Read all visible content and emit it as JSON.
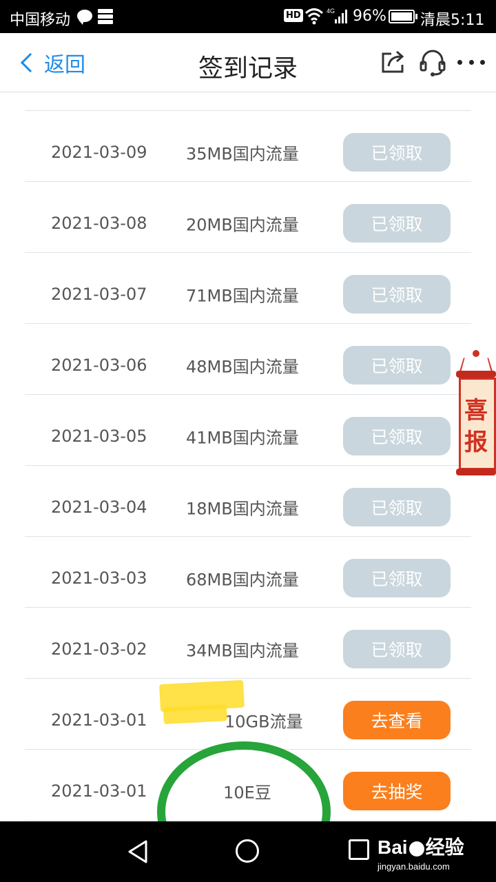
{
  "status_bar": {
    "carrier": "中国移动",
    "battery": "96%",
    "time": "清晨5:11",
    "hd": "HD",
    "network": "4G"
  },
  "nav": {
    "back_label": "返回",
    "title": "签到记录"
  },
  "records": [
    {
      "date": "2021-03-09",
      "reward": "35MB国内流量",
      "action": "已领取",
      "state": "claimed"
    },
    {
      "date": "2021-03-08",
      "reward": "20MB国内流量",
      "action": "已领取",
      "state": "claimed"
    },
    {
      "date": "2021-03-07",
      "reward": "71MB国内流量",
      "action": "已领取",
      "state": "claimed"
    },
    {
      "date": "2021-03-06",
      "reward": "48MB国内流量",
      "action": "已领取",
      "state": "claimed"
    },
    {
      "date": "2021-03-05",
      "reward": "41MB国内流量",
      "action": "已领取",
      "state": "claimed"
    },
    {
      "date": "2021-03-04",
      "reward": "18MB国内流量",
      "action": "已领取",
      "state": "claimed"
    },
    {
      "date": "2021-03-03",
      "reward": "68MB国内流量",
      "action": "已领取",
      "state": "claimed"
    },
    {
      "date": "2021-03-02",
      "reward": "34MB国内流量",
      "action": "已领取",
      "state": "claimed"
    },
    {
      "date": "2021-03-01",
      "reward": "10GB流量",
      "action": "去查看",
      "state": "active"
    },
    {
      "date": "2021-03-01",
      "reward": "10E豆",
      "action": "去抽奖",
      "state": "active"
    }
  ],
  "promo_badge": {
    "line1": "喜",
    "line2": "报"
  },
  "watermark": {
    "brand": "Bai",
    "brand2": "经验",
    "url": "jingyan.baidu.com"
  },
  "colors": {
    "accent": "#1f8ce8",
    "claimed_button": "#c9d6dd",
    "active_button": "#fb7f1d",
    "circle_annotation": "#27a43a",
    "highlighter": "#ffdc28"
  },
  "icons": {
    "back": "chevron-left-icon",
    "share": "share-icon",
    "support": "headset-icon",
    "more": "more-dots-icon"
  }
}
